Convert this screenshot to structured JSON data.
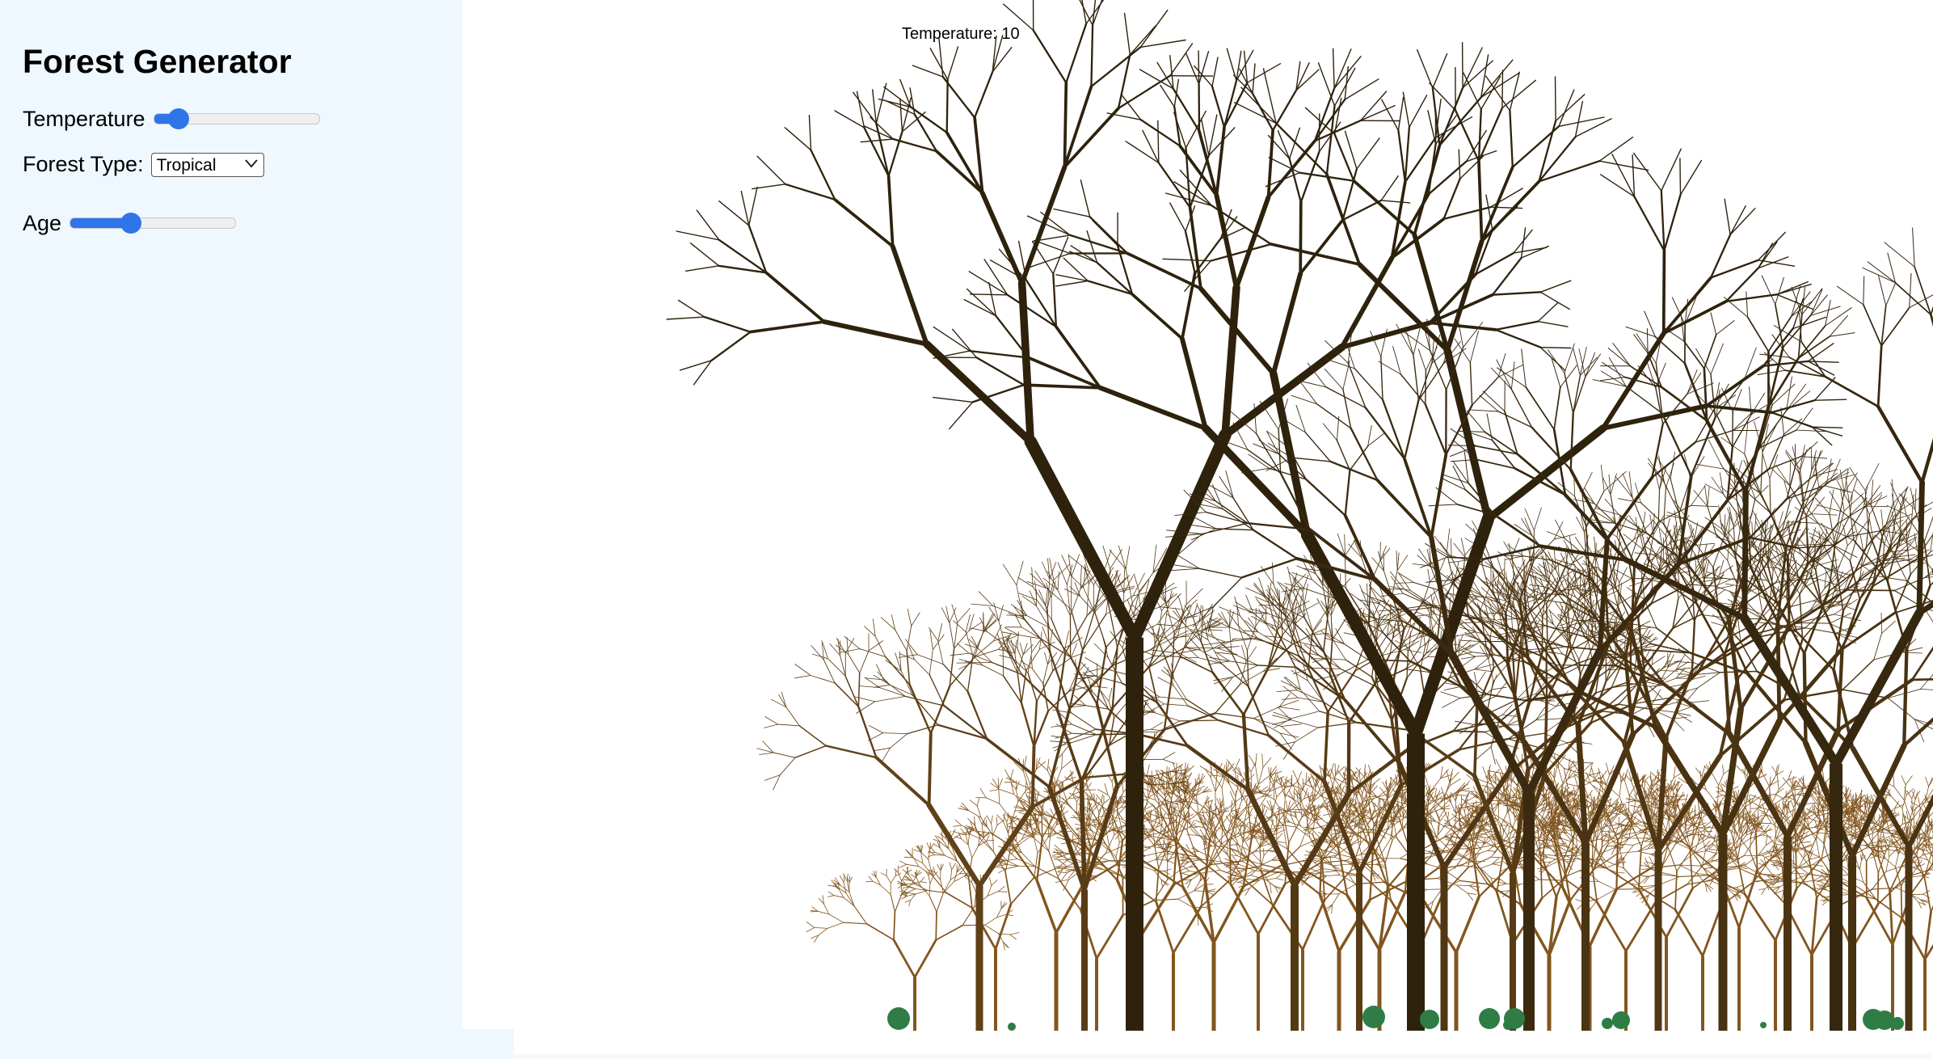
{
  "sidebar": {
    "title": "Forest Generator",
    "temperature": {
      "label": "Temperature",
      "value": 10,
      "min": 0,
      "max": 100
    },
    "forest_type": {
      "label": "Forest Type:",
      "selected": "Tropical"
    },
    "age": {
      "label": "Age",
      "value": 35,
      "min": 0,
      "max": 100
    }
  },
  "canvas": {
    "readout": "Temperature: 10"
  },
  "colors": {
    "sidebar_background": "#f0f8ff",
    "slider_accent": "#2f74e8",
    "trunk_dark": "#2e220d",
    "trunk_light": "#82561f",
    "bush_green": "#2f7d45"
  }
}
